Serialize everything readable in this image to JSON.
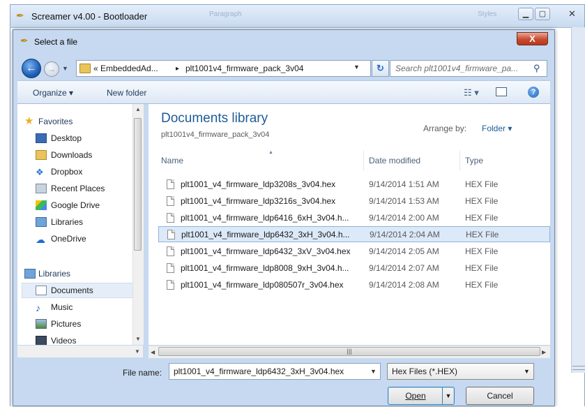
{
  "app": {
    "title": "Screamer v4.00 - Bootloader",
    "bg_ghost": [
      "Paragraph",
      "Styles"
    ]
  },
  "dialog": {
    "title": "Select a file",
    "close_label": "X"
  },
  "address": {
    "crumbs": [
      "« EmbeddedAd...",
      "▸",
      "plt1001v4_firmware_pack_3v04"
    ],
    "search_placeholder": "Search plt1001v4_firmware_pa..."
  },
  "toolbar": {
    "organize": "Organize ▾",
    "new_folder": "New folder"
  },
  "navpane": {
    "favorites": "Favorites",
    "favorite_items": [
      "Desktop",
      "Downloads",
      "Dropbox",
      "Recent Places",
      "Google Drive",
      "Libraries",
      "OneDrive"
    ],
    "libraries": "Libraries",
    "library_items": [
      "Documents",
      "Music",
      "Pictures",
      "Videos"
    ]
  },
  "library": {
    "title": "Documents library",
    "subtitle": "plt1001v4_firmware_pack_3v04",
    "arrange_label": "Arrange by:",
    "arrange_value": "Folder ▾"
  },
  "columns": {
    "name": "Name",
    "date": "Date modified",
    "type": "Type"
  },
  "files": [
    {
      "name": "plt1001_v4_firmware_ldp3208s_3v04.hex",
      "date": "9/14/2014 1:51 AM",
      "type": "HEX File"
    },
    {
      "name": "plt1001_v4_firmware_ldp3216s_3v04.hex",
      "date": "9/14/2014 1:53 AM",
      "type": "HEX File"
    },
    {
      "name": "plt1001_v4_firmware_ldp6416_6xH_3v04.h...",
      "date": "9/14/2014 2:00 AM",
      "type": "HEX File"
    },
    {
      "name": "plt1001_v4_firmware_ldp6432_3xH_3v04.h...",
      "date": "9/14/2014 2:04 AM",
      "type": "HEX File",
      "selected": true
    },
    {
      "name": "plt1001_v4_firmware_ldp6432_3xV_3v04.hex",
      "date": "9/14/2014 2:05 AM",
      "type": "HEX File"
    },
    {
      "name": "plt1001_v4_firmware_ldp8008_9xH_3v04.h...",
      "date": "9/14/2014 2:07 AM",
      "type": "HEX File"
    },
    {
      "name": "plt1001_v4_firmware_ldp080507r_3v04.hex",
      "date": "9/14/2014 2:08 AM",
      "type": "HEX File"
    }
  ],
  "bottom": {
    "filename_label": "File name:",
    "filename_value": "plt1001_v4_firmware_ldp6432_3xH_3v04.hex",
    "filter_value": "Hex Files (*.HEX)",
    "open_label": "Open",
    "cancel_label": "Cancel"
  },
  "colors": {
    "accent": "#1e5b96",
    "selection": "#dbe9f8",
    "close_red": "#c74a2e"
  }
}
